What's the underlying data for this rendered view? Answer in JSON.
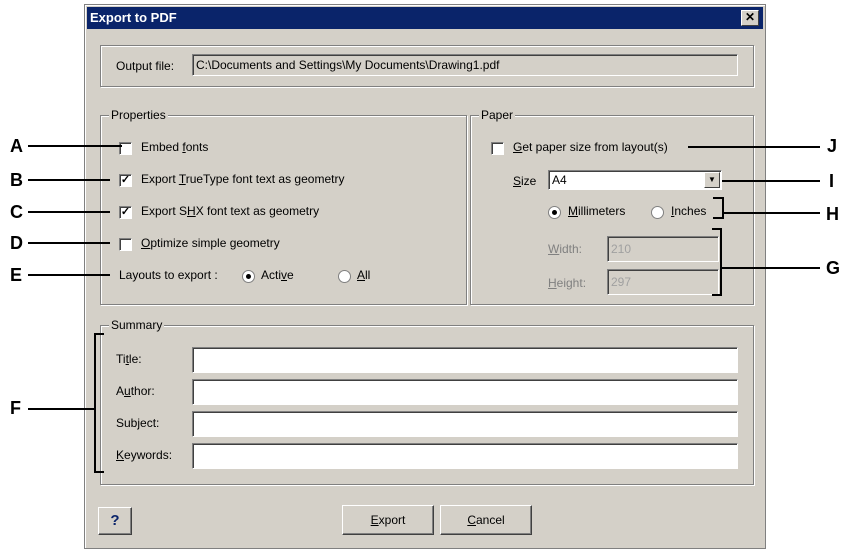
{
  "dialog": {
    "title": "Export to PDF",
    "close_glyph": "✕"
  },
  "output": {
    "label": "Output file:",
    "value": "C:\\Documents and Settings\\My Documents\\Drawing1.pdf"
  },
  "properties": {
    "group_label": "Properties",
    "embed_fonts": {
      "pre": "Embed ",
      "key": "f",
      "post": "onts",
      "checked": false
    },
    "export_truetype": {
      "pre": "Export ",
      "key": "T",
      "post": "rueType font text as geometry",
      "checked": true
    },
    "export_shx": {
      "pre": "Export S",
      "key": "H",
      "post": "X font text as geometry",
      "checked": true
    },
    "optimize": {
      "pre": "",
      "key": "O",
      "post": "ptimize simple geometry",
      "checked": false
    },
    "layouts_label": "Layouts to export :",
    "active": {
      "pre": "Acti",
      "key": "v",
      "post": "e",
      "selected": true
    },
    "all": {
      "pre": "",
      "key": "A",
      "post": "ll",
      "selected": false
    }
  },
  "paper": {
    "group_label": "Paper",
    "get_size": {
      "pre": "",
      "key": "G",
      "post": "et paper size from layout(s)",
      "checked": false
    },
    "size_label": {
      "pre": "",
      "key": "S",
      "post": "ize"
    },
    "size_value": "A4",
    "millimeters": {
      "pre": "",
      "key": "M",
      "post": "illimeters",
      "selected": true
    },
    "inches": {
      "pre": "",
      "key": "I",
      "post": "nches",
      "selected": false
    },
    "width_label": {
      "pre": "",
      "key": "W",
      "post": "idth:"
    },
    "width_value": "210",
    "height_label": {
      "pre": "",
      "key": "H",
      "post": "eight:"
    },
    "height_value": "297"
  },
  "summary": {
    "group_label": "Summary",
    "title_label": {
      "pre": "Ti",
      "key": "t",
      "post": "le:"
    },
    "author_label": {
      "pre": "A",
      "key": "u",
      "post": "thor:"
    },
    "subject_label": "Subject:",
    "keywords_label": {
      "pre": "",
      "key": "K",
      "post": "eywords:"
    }
  },
  "buttons": {
    "help": "?",
    "export": {
      "pre": "",
      "key": "E",
      "post": "xport"
    },
    "cancel": {
      "pre": "",
      "key": "C",
      "post": "ancel"
    }
  },
  "callouts": {
    "A": "A",
    "B": "B",
    "C": "C",
    "D": "D",
    "E": "E",
    "F": "F",
    "G": "G",
    "H": "H",
    "I": "I",
    "J": "J"
  }
}
